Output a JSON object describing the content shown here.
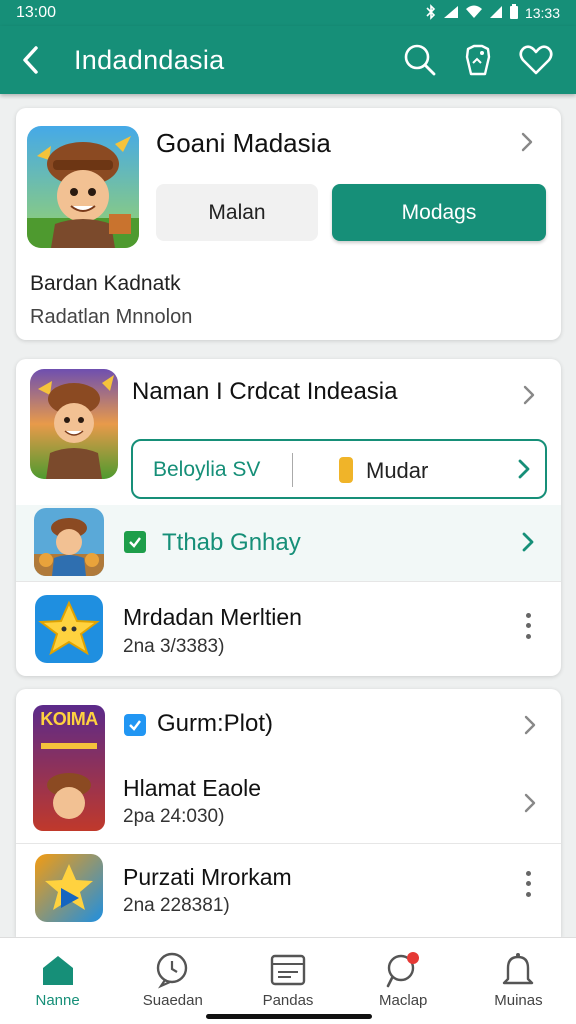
{
  "status": {
    "time": "13:00",
    "right_time": "13:33"
  },
  "header": {
    "title": "Indadndasia"
  },
  "card1": {
    "title": "Goani Madasia",
    "left_button": "Malan",
    "right_button": "Modags",
    "line1": "Bardan Kadnatk",
    "line2": "Radatlan Mnnolon"
  },
  "card2": {
    "title": "Naman I Crdcat Indeasia",
    "chip_left": "Beloylia SV",
    "chip_right": "Mudar",
    "row1_title": "Tthab Gnhay",
    "row2_title": "Mrdadan Merltien",
    "row2_sub": "2na 3/3383)"
  },
  "card3": {
    "thumb_text": "KOIMA",
    "title": "Gurm:Plot)",
    "row1_title": "Hlamat Eaole",
    "row1_sub": "2pa 24:030)",
    "row2_title": "Purzati Mrorkam",
    "row2_sub": "2na 228381)"
  },
  "nav": {
    "items": [
      {
        "label": "Nanne"
      },
      {
        "label": "Suaedan"
      },
      {
        "label": "Pandas"
      },
      {
        "label": "Maclap"
      },
      {
        "label": "Muinas"
      }
    ]
  },
  "colors": {
    "brand": "#168f78",
    "notification": "#e53935",
    "check": "#1e9e4a",
    "verified": "#2196f3"
  }
}
